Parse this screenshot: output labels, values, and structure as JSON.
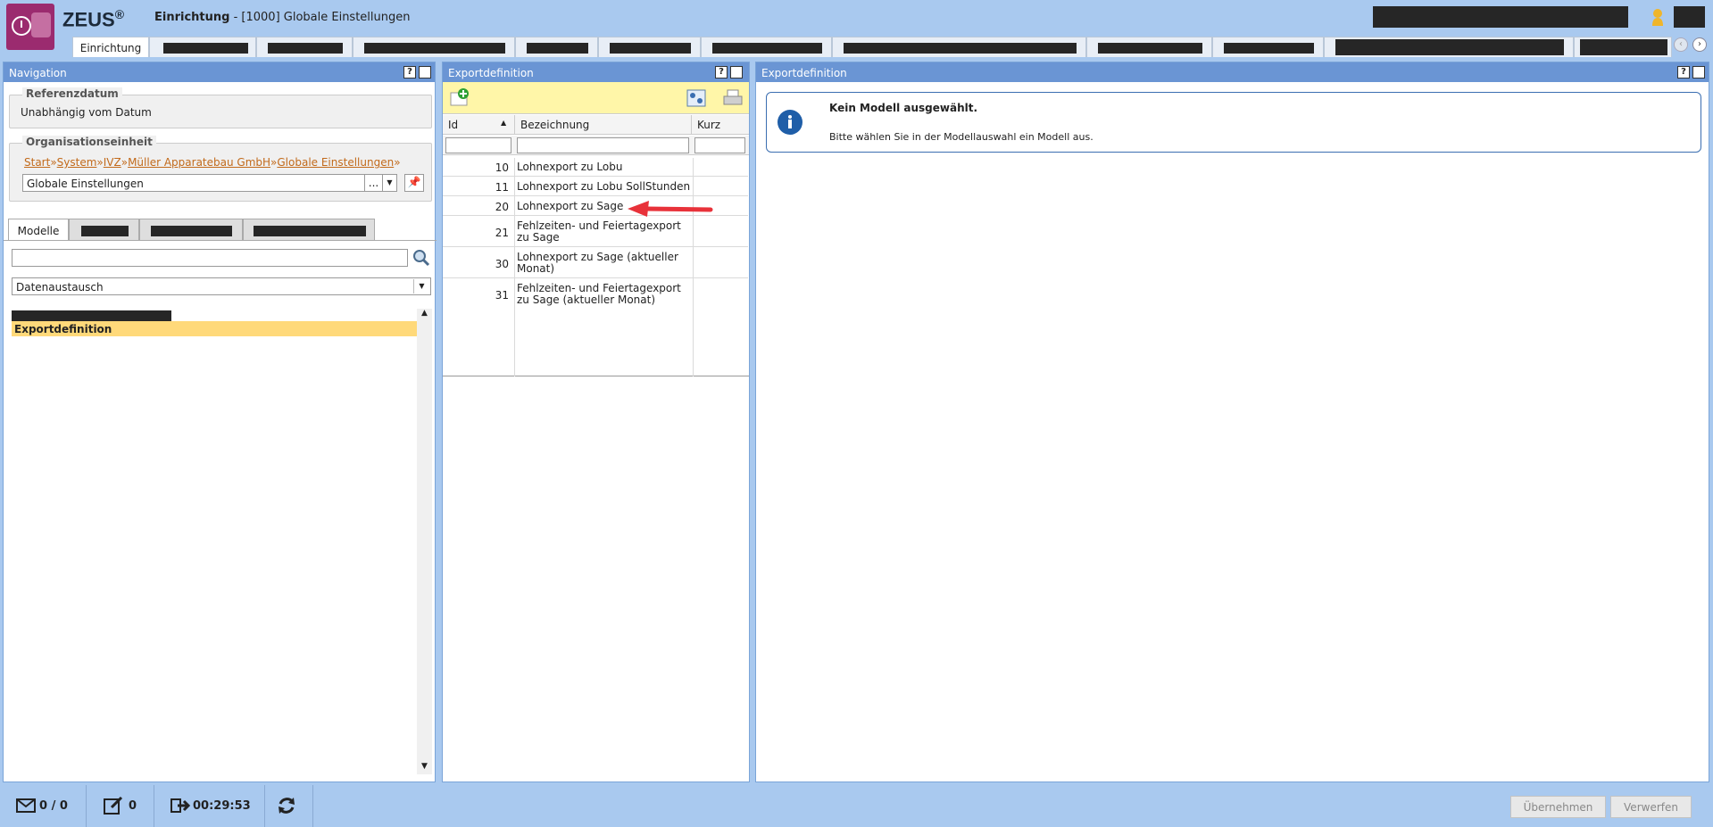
{
  "app": {
    "name": "ZEUS",
    "name_mark": "®",
    "title_bold": "Einrichtung",
    "title_rest": " - [1000] Globale Einstellungen"
  },
  "top_tabs": {
    "active_label": "Einrichtung"
  },
  "navigation": {
    "header": "Navigation",
    "help": "?",
    "referenzdatum_legend": "Referenzdatum",
    "referenzdatum_value": "Unabhängig vom Datum",
    "orgeinheit_legend": "Organisationseinheit",
    "breadcrumb": [
      "Start",
      "System",
      "IVZ",
      "Müller Apparatebau GmbH",
      "Globale Einstellungen"
    ],
    "breadcrumb_sep": "»",
    "org_field_value": "Globale Einstellungen",
    "org_dots": "...",
    "tab_modelle": "Modelle",
    "search_value": "",
    "category_select": "Datenaustausch",
    "selected_item": "Exportdefinition"
  },
  "exportdef_list": {
    "header": "Exportdefinition",
    "help": "?",
    "columns": [
      "Id",
      "Bezeichnung",
      "Kurz"
    ],
    "rows": [
      {
        "id": "10",
        "bez1": "Lohnexport zu Lobu",
        "bez2": ""
      },
      {
        "id": "11",
        "bez1": "Lohnexport zu Lobu SollStunden",
        "bez2": ""
      },
      {
        "id": "20",
        "bez1": "Lohnexport zu Sage",
        "bez2": ""
      },
      {
        "id": "21",
        "bez1": "Fehlzeiten- und Feiertagexport",
        "bez2": "zu Sage"
      },
      {
        "id": "30",
        "bez1": "Lohnexport zu Sage (aktueller",
        "bez2": "Monat)"
      },
      {
        "id": "31",
        "bez1": "Fehlzeiten- und Feiertagexport",
        "bez2": "zu Sage (aktueller Monat)"
      }
    ]
  },
  "detail": {
    "header": "Exportdefinition",
    "help": "?",
    "info_title": "Kein Modell ausgewählt.",
    "info_text": "Bitte wählen Sie in der Modellauswahl ein Modell aus."
  },
  "statusbar": {
    "messages": "0 / 0",
    "edits": "0",
    "session_time": "00:29:53",
    "apply_label": "Übernehmen",
    "discard_label": "Verwerfen"
  },
  "colors": {
    "accent": "#6a95d4",
    "highlight": "#ffd97a",
    "annotation": "#e8323a"
  }
}
